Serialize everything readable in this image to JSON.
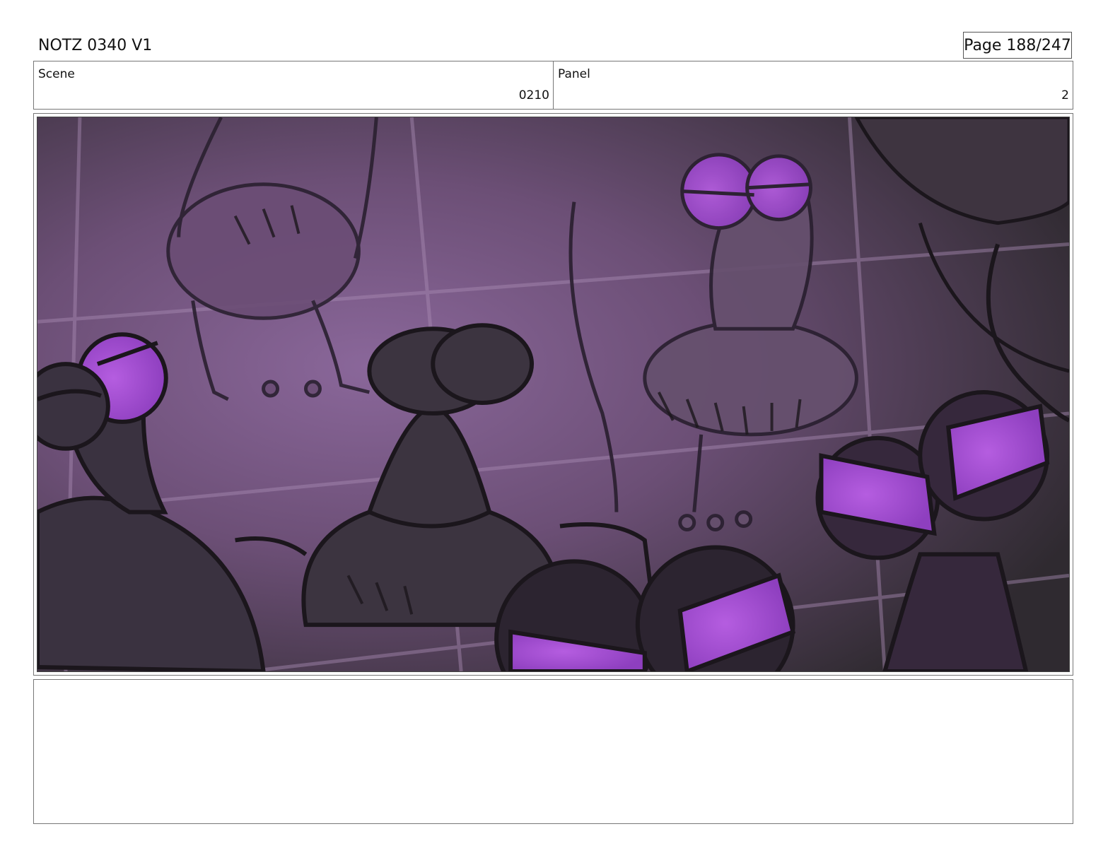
{
  "header": {
    "project_title": "NOTZ 0340 V1",
    "page_indicator": "Page 188/247"
  },
  "info": {
    "scene_label": "Scene",
    "scene_value": "0210",
    "panel_label": "Panel",
    "panel_value": "2"
  },
  "panel_art": {
    "subject": "storyboard-sketch-frogs",
    "colors": {
      "background_dark": "#2f2a30",
      "background_purple": "#7e5a8a",
      "frog_body": "#3d3540",
      "eye_glow": "#a24fd0",
      "line": "#1b161c"
    }
  },
  "notes": {
    "text": ""
  }
}
